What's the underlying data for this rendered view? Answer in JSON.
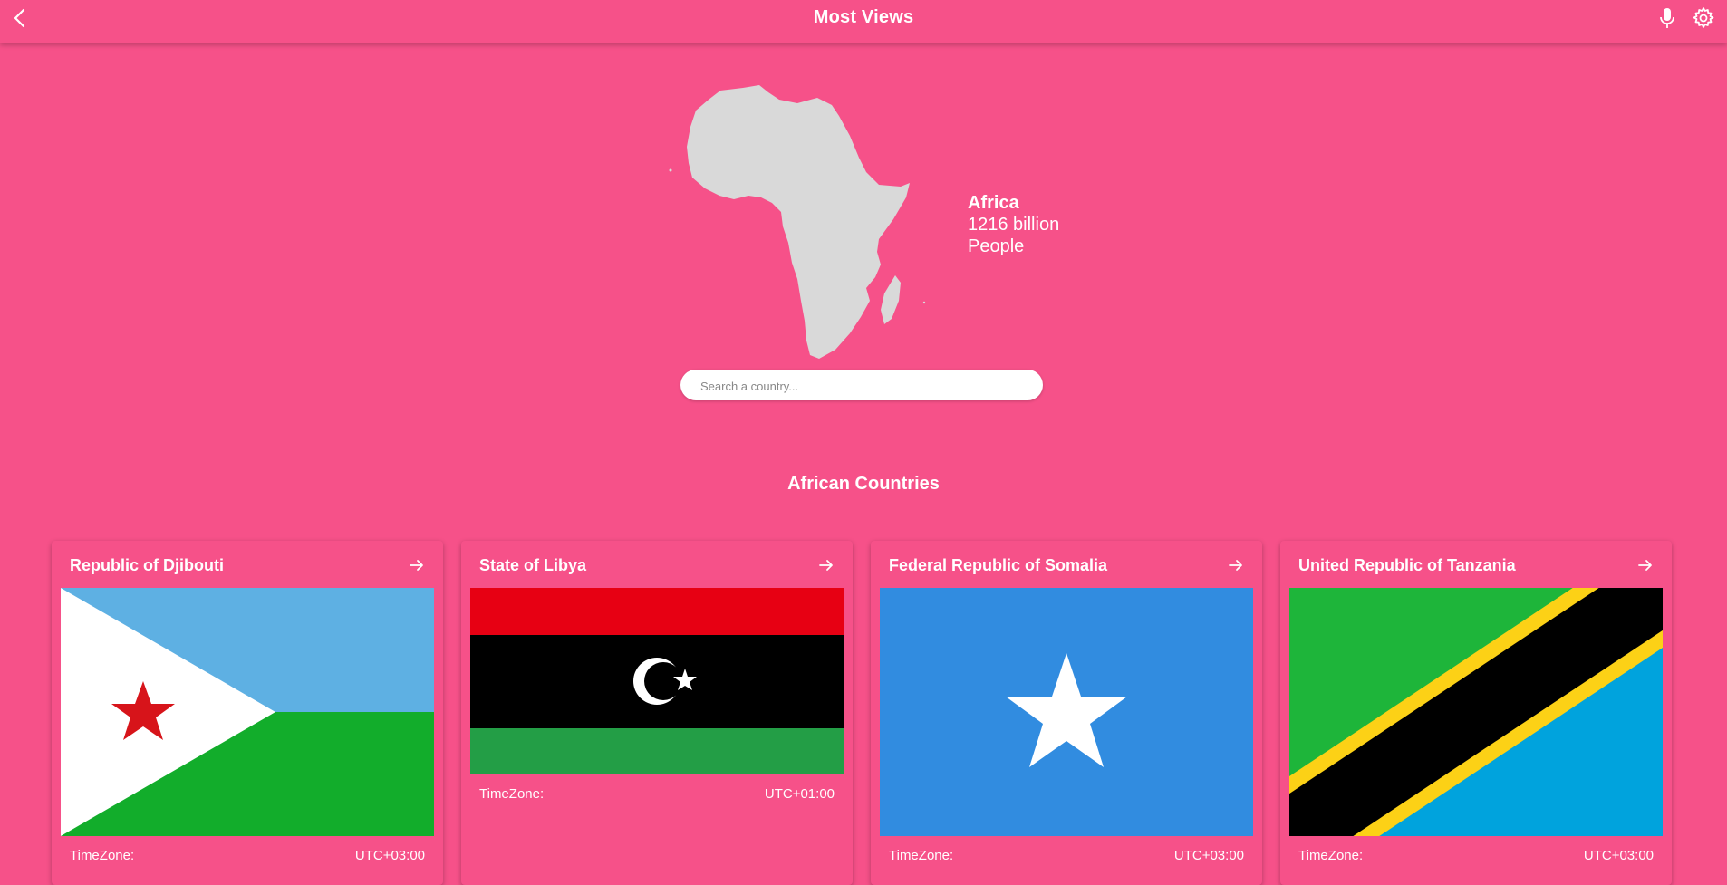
{
  "header": {
    "title": "Most Views",
    "icons": [
      "back-arrow-icon",
      "microphone-icon",
      "gear-icon"
    ]
  },
  "continent": {
    "name": "Africa",
    "population": "1216 billion",
    "population_unit": "People"
  },
  "search": {
    "placeholder": "Search a country..."
  },
  "section": {
    "title": "African Countries"
  },
  "countries": [
    {
      "name": "Republic of Djibouti",
      "timezone_label": "TimeZone:",
      "timezone": "UTC+03:00",
      "flag": "djibouti-flag"
    },
    {
      "name": "State of Libya",
      "timezone_label": "TimeZone:",
      "timezone": "UTC+01:00",
      "flag": "libya-flag"
    },
    {
      "name": "Federal Republic of Somalia",
      "timezone_label": "TimeZone:",
      "timezone": "UTC+03:00",
      "flag": "somalia-flag"
    },
    {
      "name": "United Republic of Tanzania",
      "timezone_label": "TimeZone:",
      "timezone": "UTC+03:00",
      "flag": "tanzania-flag"
    }
  ],
  "colors": {
    "background": "#f65189",
    "text": "#ffffff",
    "map": "#d9d9d9"
  }
}
